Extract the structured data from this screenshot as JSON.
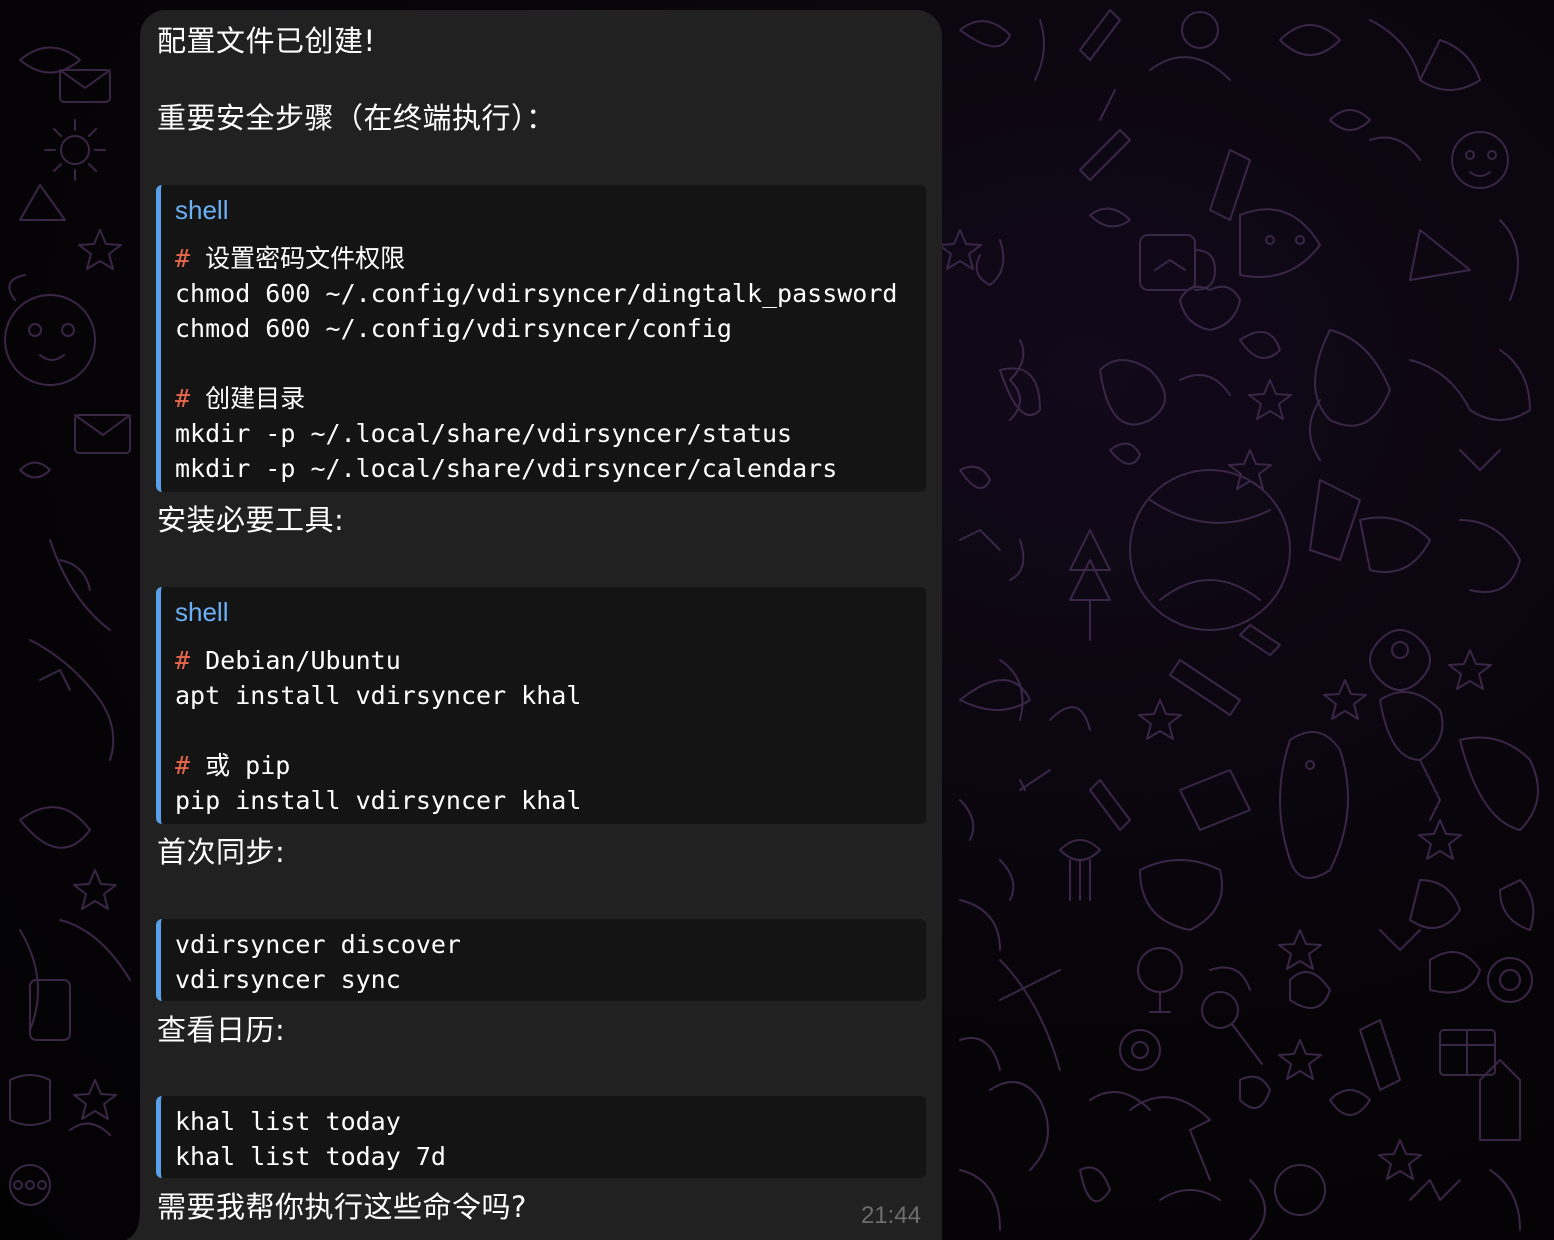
{
  "message": {
    "intro": "配置文件已创建!",
    "security_heading": "重要安全步骤（在终端执行）：",
    "install_heading": "安装必要工具:",
    "first_sync_heading": "首次同步:",
    "view_calendar_heading": "查看日历:",
    "closing_question": "需要我帮你执行这些命令吗?",
    "timestamp": "21:44"
  },
  "code_blocks": [
    {
      "language": "shell",
      "lines": [
        {
          "hash": "#",
          "text": " 设置密码文件权限"
        },
        {
          "text": "chmod 600 ~/.config/vdirsyncer/dingtalk_password"
        },
        {
          "text": "chmod 600 ~/.config/vdirsyncer/config"
        },
        {
          "text": ""
        },
        {
          "hash": "#",
          "text": " 创建目录"
        },
        {
          "text": "mkdir -p ~/.local/share/vdirsyncer/status"
        },
        {
          "text": "mkdir -p ~/.local/share/vdirsyncer/calendars"
        }
      ]
    },
    {
      "language": "shell",
      "lines": [
        {
          "hash": "#",
          "text": " Debian/Ubuntu"
        },
        {
          "text": "apt install vdirsyncer khal"
        },
        {
          "text": ""
        },
        {
          "hash": "#",
          "text": " 或 pip"
        },
        {
          "text": "pip install vdirsyncer khal"
        }
      ]
    },
    {
      "language": "",
      "lines": [
        {
          "text": "vdirsyncer discover"
        },
        {
          "text": "vdirsyncer sync"
        }
      ]
    },
    {
      "language": "",
      "lines": [
        {
          "text": "khal list today"
        },
        {
          "text": "khal list today 7d"
        }
      ]
    }
  ],
  "colors": {
    "bubble": "#212121",
    "code_bg": "#141414",
    "code_accent": "#5aa0e8",
    "comment_hash": "#e8664c",
    "timestamp": "#6d6d6d"
  }
}
